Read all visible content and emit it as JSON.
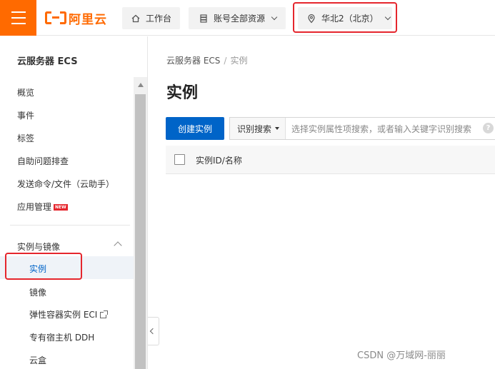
{
  "topbar": {
    "brand": "阿里云",
    "workbench": "工作台",
    "resources": "账号全部资源",
    "region": "华北2（北京）"
  },
  "sidebar": {
    "title": "云服务器 ECS",
    "items": [
      "概览",
      "事件",
      "标签",
      "自助问题排查",
      "发送命令/文件（云助手）",
      "应用管理"
    ],
    "new_badge": "NEW",
    "group_label": "实例与镜像",
    "active_item": "实例",
    "sub_items": [
      "镜像",
      "弹性容器实例 ECI",
      "专有宿主机 DDH",
      "云盒"
    ]
  },
  "main": {
    "breadcrumb_root": "云服务器 ECS",
    "breadcrumb_sep": "/",
    "breadcrumb_current": "实例",
    "page_title": "实例",
    "create_button": "创建实例",
    "search_prefix": "识别搜索",
    "search_placeholder": "选择实例属性项搜索，或者输入关键字识别搜索",
    "help": "?",
    "column_id_name": "实例ID/名称"
  },
  "watermark": "CSDN @万域网-丽丽",
  "colors": {
    "brand_orange": "#ff6a00",
    "primary_blue": "#0064c8",
    "highlight_red": "#e5262d"
  }
}
